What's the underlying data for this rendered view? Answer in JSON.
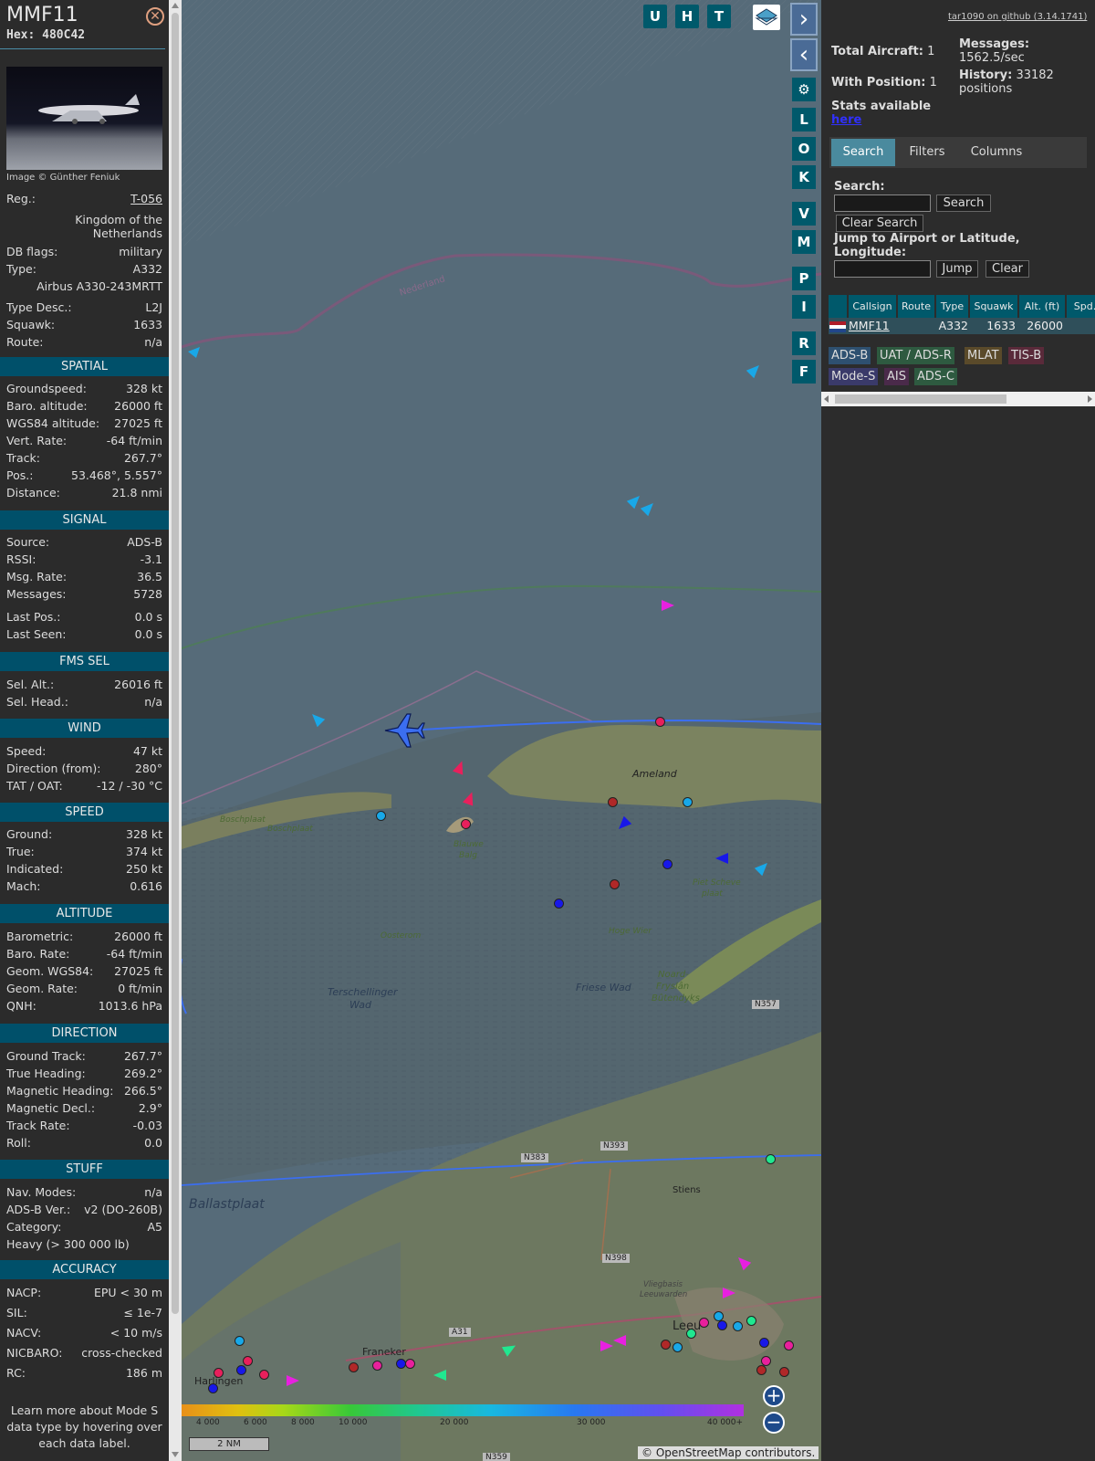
{
  "info": {
    "callsign": "MMF11",
    "hex": "Hex: 480C42",
    "photo_credit": "Image © Günther Feniuk",
    "reg_label": "Reg.:",
    "reg_value": "T-056",
    "country": "Kingdom of the Netherlands",
    "dbflags_label": "DB flags:",
    "dbflags_value": "military",
    "type_label": "Type:",
    "type_value": "A332",
    "type_full": "Airbus A330-243MRTT",
    "typedesc_label": "Type Desc.:",
    "typedesc_value": "L2J",
    "squawk_label": "Squawk:",
    "squawk_value": "1633",
    "route_label": "Route:",
    "route_value": "n/a",
    "sections": {
      "spatial": "SPATIAL",
      "signal": "SIGNAL",
      "fms": "FMS SEL",
      "wind": "WIND",
      "speed": "SPEED",
      "altitude": "ALTITUDE",
      "direction": "DIRECTION",
      "stuff": "STUFF",
      "accuracy": "ACCURACY"
    },
    "spatial": [
      {
        "k": "Groundspeed:",
        "v": "328 kt"
      },
      {
        "k": "Baro. altitude:",
        "v": "26000 ft"
      },
      {
        "k": "WGS84 altitude:",
        "v": "27025 ft"
      },
      {
        "k": "Vert. Rate:",
        "v": "-64 ft/min"
      },
      {
        "k": "Track:",
        "v": "267.7°"
      },
      {
        "k": "Pos.:",
        "v": "53.468°, 5.557°"
      },
      {
        "k": "Distance:",
        "v": "21.8 nmi"
      }
    ],
    "signal": [
      {
        "k": "Source:",
        "v": "ADS-B"
      },
      {
        "k": "RSSI:",
        "v": "-3.1"
      },
      {
        "k": "Msg. Rate:",
        "v": "36.5"
      },
      {
        "k": "Messages:",
        "v": "5728"
      },
      {
        "k": "Last Pos.:",
        "v": "0.0 s"
      },
      {
        "k": "Last Seen:",
        "v": "0.0 s"
      }
    ],
    "fms": [
      {
        "k": "Sel. Alt.:",
        "v": "26016 ft"
      },
      {
        "k": "Sel. Head.:",
        "v": "n/a"
      }
    ],
    "wind": [
      {
        "k": "Speed:",
        "v": "47 kt"
      },
      {
        "k": "Direction (from):",
        "v": "280°"
      },
      {
        "k": "TAT / OAT:",
        "v": "-12 / -30 °C"
      }
    ],
    "speed": [
      {
        "k": "Ground:",
        "v": "328 kt"
      },
      {
        "k": "True:",
        "v": "374 kt"
      },
      {
        "k": "Indicated:",
        "v": "250 kt"
      },
      {
        "k": "Mach:",
        "v": "0.616"
      }
    ],
    "altitude": [
      {
        "k": "Barometric:",
        "v": "26000 ft"
      },
      {
        "k": "Baro. Rate:",
        "v": "-64 ft/min"
      },
      {
        "k": "Geom. WGS84:",
        "v": "27025 ft"
      },
      {
        "k": "Geom. Rate:",
        "v": "0 ft/min"
      },
      {
        "k": "QNH:",
        "v": "1013.6 hPa"
      }
    ],
    "direction": [
      {
        "k": "Ground Track:",
        "v": "267.7°"
      },
      {
        "k": "True Heading:",
        "v": "269.2°"
      },
      {
        "k": "Magnetic Heading:",
        "v": "266.5°"
      },
      {
        "k": "Magnetic Decl.:",
        "v": "2.9°"
      },
      {
        "k": "Track Rate:",
        "v": "-0.03"
      },
      {
        "k": "Roll:",
        "v": "0.0"
      }
    ],
    "stuff": [
      {
        "k": "Nav. Modes:",
        "v": "n/a"
      },
      {
        "k": "ADS-B Ver.:",
        "v": "v2 (DO-260B)"
      },
      {
        "k": "Category:",
        "v": "A5"
      }
    ],
    "stuff_extra": "Heavy (> 300 000 lb)",
    "accuracy": [
      {
        "k": "NACP:",
        "v": "EPU < 30 m"
      },
      {
        "k": "SIL:",
        "v": "≤ 1e-7"
      },
      {
        "k": "NACV:",
        "v": "< 10 m/s"
      },
      {
        "k": "NICBARO:",
        "v": "cross-checked"
      },
      {
        "k": "RC:",
        "v": "186 m"
      }
    ],
    "note": "Learn more about Mode S data type by hovering over each data label."
  },
  "map": {
    "top_buttons": [
      "U",
      "H",
      "T"
    ],
    "side_buttons": [
      "L",
      "O",
      "K",
      "V",
      "M",
      "P",
      "I",
      "R",
      "F"
    ],
    "labels": {
      "nederland": "Nederland",
      "ameland": "Ameland",
      "boschplaat1": "Boschplaat",
      "boschplaat2": "Boschplaat",
      "blauwe": "Blauwe",
      "balg": "Balg",
      "oosterom": "Oosterom",
      "hoge_wier": "Hoge Wier",
      "piet1": "Piet Scheve",
      "piet2": "plaat",
      "terschel1": "Terschellinger",
      "terschel2": "Wad",
      "friese": "Friese Wad",
      "noord1": "Noard-",
      "noord2": "Fryslân",
      "noord3": "Bûtendyks",
      "ballast": "Ballastplaat",
      "stiens": "Stiens",
      "franeker": "Franeker",
      "leeuwarden": "Leeu",
      "harlingen": "Harlingen",
      "vlieg1": "Vliegbasis",
      "vlieg2": "Leeuwarden",
      "n357": "N357",
      "n393": "N393",
      "n383": "N383",
      "n398": "N398",
      "a31": "A31",
      "n359": "N359"
    },
    "scale": "2 NM",
    "attribution": "© OpenStreetMap contributors.",
    "color_scale_ticks": [
      "4 000",
      "6 000",
      "8 000",
      "10 000",
      "20 000",
      "30 000",
      "40 000+"
    ]
  },
  "sidebar": {
    "version_link": "tar1090 on github (3.14.1741)",
    "total_label": "Total Aircraft:",
    "total_value": "1",
    "withpos_label": "With Position:",
    "withpos_value": "1",
    "messages_label": "Messages:",
    "messages_value": "1562.5/sec",
    "history_label": "History:",
    "history_value": "33182 positions",
    "stats_label": "Stats available",
    "stats_link": "here",
    "tabs": [
      "Search",
      "Filters",
      "Columns"
    ],
    "search_label": "Search:",
    "search_btn": "Search",
    "clear_search_btn": "Clear Search",
    "jump_label": "Jump to Airport or Latitude, Longitude:",
    "jump_btn": "Jump",
    "clear_btn": "Clear",
    "columns": [
      "Callsign",
      "Route",
      "Type",
      "Squawk",
      "Alt. (ft)",
      "Spd."
    ],
    "row": {
      "callsign": "MMF11",
      "route": "",
      "type": "A332",
      "squawk": "1633",
      "alt": "26000",
      "spd": ""
    },
    "chips": [
      "ADS-B",
      "UAT / ADS-R",
      "MLAT",
      "TIS-B",
      "Mode-S",
      "AIS",
      "ADS-C"
    ]
  }
}
